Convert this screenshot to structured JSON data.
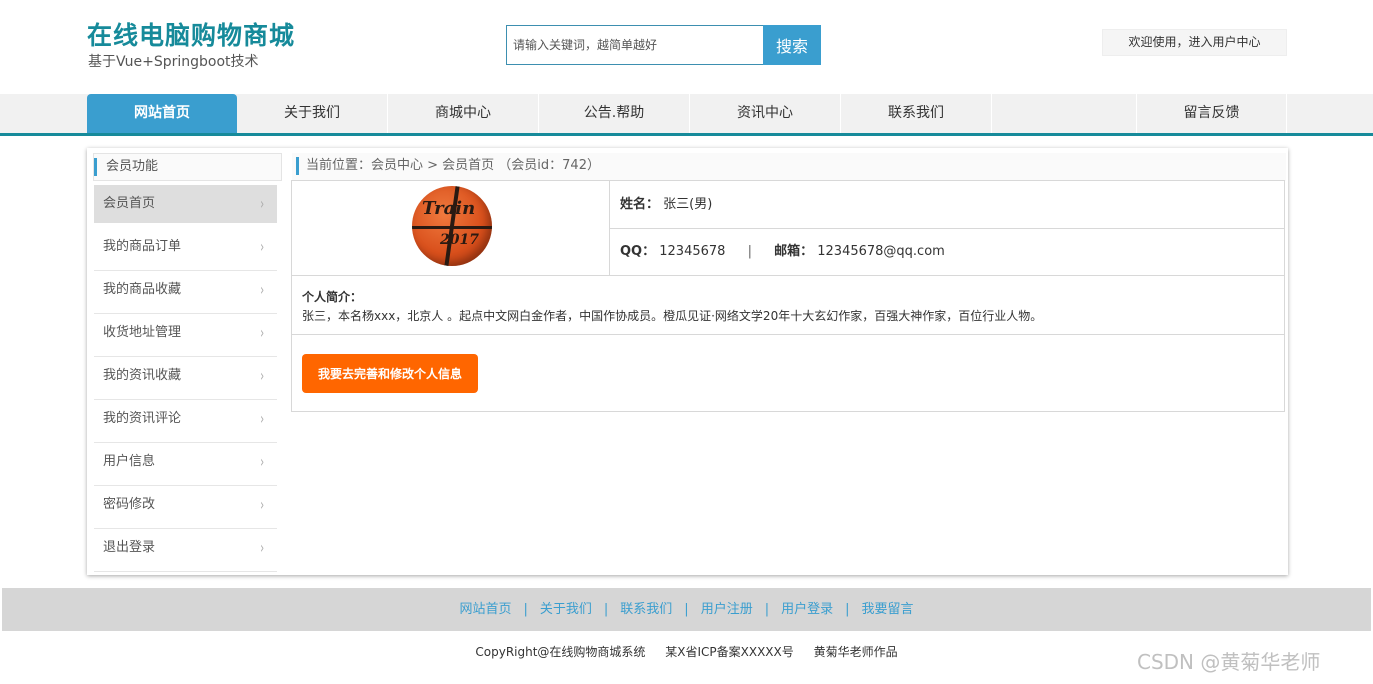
{
  "header": {
    "title": "在线电脑购物商城",
    "subtitle": "基于Vue+Springboot技术",
    "search_placeholder": "请输入关键词，越简单越好",
    "search_button": "搜索",
    "welcome": "欢迎使用，进入用户中心"
  },
  "nav": {
    "items": [
      {
        "label": "网站首页"
      },
      {
        "label": "关于我们"
      },
      {
        "label": "商城中心"
      },
      {
        "label": "公告.帮助"
      },
      {
        "label": "资讯中心"
      },
      {
        "label": "联系我们"
      },
      {
        "label": "留言反馈"
      }
    ]
  },
  "sidebar": {
    "title": "会员功能",
    "items": [
      {
        "label": "会员首页"
      },
      {
        "label": "我的商品订单"
      },
      {
        "label": "我的商品收藏"
      },
      {
        "label": "收货地址管理"
      },
      {
        "label": "我的资讯收藏"
      },
      {
        "label": "我的资讯评论"
      },
      {
        "label": "用户信息"
      },
      {
        "label": "密码修改"
      },
      {
        "label": "退出登录"
      }
    ],
    "chevron": "›"
  },
  "content": {
    "breadcrumb": "当前位置：会员中心 > 会员首页 （会员id：742）",
    "avatar_brand": "Train",
    "avatar_year": "2017",
    "name_label": "姓名：",
    "name_value": "张三(男)",
    "qq_label": "QQ：",
    "qq_value": "12345678",
    "separator": "|",
    "email_label": "邮箱：",
    "email_value": "12345678@qq.com",
    "intro_label": "个人简介：",
    "intro_text": "张三，本名杨xxx，北京人 。起点中文网白金作者，中国作协成员。橙瓜见证·网络文学20年十大玄幻作家，百强大神作家，百位行业人物。",
    "edit_button": "我要去完善和修改个人信息"
  },
  "footer": {
    "links": [
      {
        "label": "网站首页"
      },
      {
        "label": "关于我们"
      },
      {
        "label": "联系我们"
      },
      {
        "label": "用户注册"
      },
      {
        "label": "用户登录"
      },
      {
        "label": "我要留言"
      }
    ],
    "pipe": "|",
    "copyright": "CopyRight@在线购物商城系统",
    "icp": "某X省ICP备案XXXXX号",
    "author": "黄菊华老师作品",
    "watermark": "CSDN @黄菊华老师"
  },
  "colors": {
    "brand": "#168a9a",
    "accent": "#3a9ecf",
    "button": "#ff6600"
  }
}
